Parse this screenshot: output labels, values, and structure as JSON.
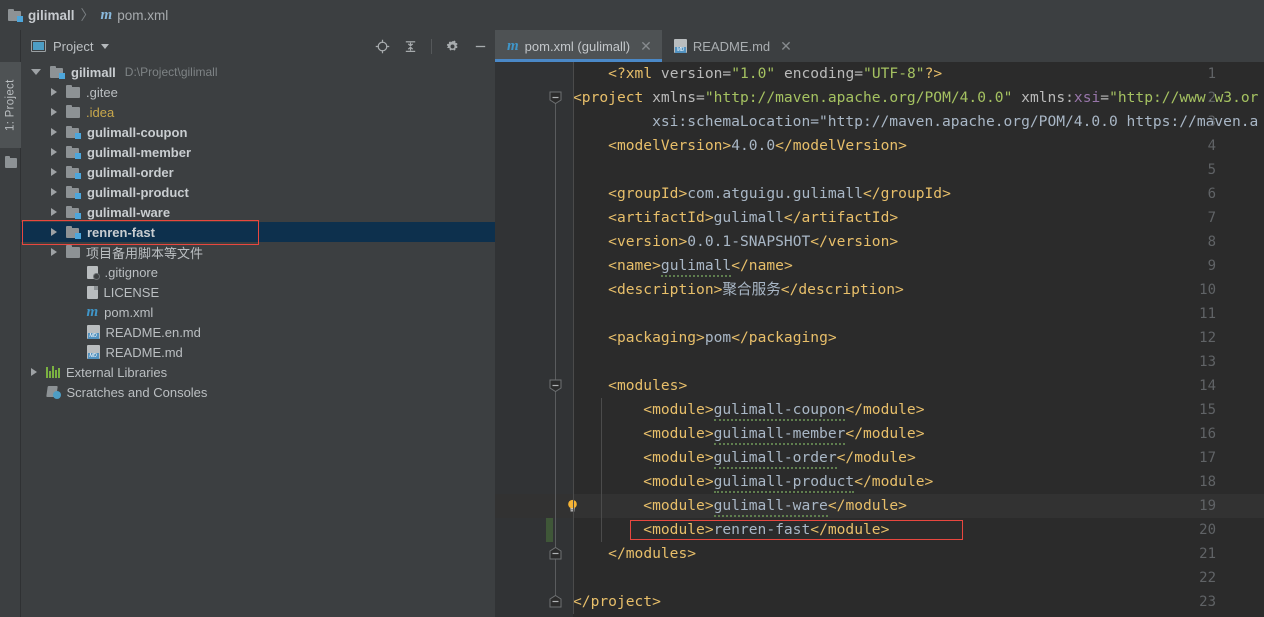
{
  "breadcrumb": {
    "project_icon": "module-icon",
    "project": "gilimall",
    "separator": "〉",
    "file_icon": "maven-m-icon",
    "file": "pom.xml"
  },
  "left_strip": {
    "project_tool_label": "1: Project",
    "folder_icon": "folder-icon"
  },
  "project_panel": {
    "title": "Project",
    "view_icon": "project-view-icon",
    "dropdown_icon": "chevron-down-icon",
    "toolbar": [
      {
        "name": "locate-icon",
        "title": "Select Opened File"
      },
      {
        "name": "collapse-all-icon",
        "title": "Collapse All"
      },
      {
        "name": "gear-icon",
        "title": "Settings"
      },
      {
        "name": "minimize-icon",
        "title": "Hide"
      }
    ],
    "tree": [
      {
        "label": "gilimall",
        "path": "D:\\Project\\gilimall",
        "icon": "module-icon",
        "arrow": "open",
        "indent": 0,
        "bold": true
      },
      {
        "label": ".gitee",
        "path": "",
        "icon": "folder-icon",
        "arrow": "closed",
        "indent": 1,
        "bold": false
      },
      {
        "label": ".idea",
        "path": "",
        "icon": "folder-icon",
        "arrow": "closed",
        "indent": 1,
        "bold": false,
        "yellow": true
      },
      {
        "label": "gulimall-coupon",
        "path": "",
        "icon": "module-icon",
        "arrow": "closed",
        "indent": 1,
        "bold": true
      },
      {
        "label": "gulimall-member",
        "path": "",
        "icon": "module-icon",
        "arrow": "closed",
        "indent": 1,
        "bold": true
      },
      {
        "label": "gulimall-order",
        "path": "",
        "icon": "module-icon",
        "arrow": "closed",
        "indent": 1,
        "bold": true
      },
      {
        "label": "gulimall-product",
        "path": "",
        "icon": "module-icon",
        "arrow": "closed",
        "indent": 1,
        "bold": true
      },
      {
        "label": "gulimall-ware",
        "path": "",
        "icon": "module-icon",
        "arrow": "closed",
        "indent": 1,
        "bold": true
      },
      {
        "label": "renren-fast",
        "path": "",
        "icon": "module-icon",
        "arrow": "closed",
        "indent": 1,
        "bold": true,
        "selected": true,
        "highlighted": true
      },
      {
        "label": "项目备用脚本等文件",
        "path": "",
        "icon": "folder-icon",
        "arrow": "closed",
        "indent": 1,
        "bold": false
      },
      {
        "label": ".gitignore",
        "path": "",
        "icon": "gitignore-icon",
        "arrow": "none",
        "indent": 2,
        "bold": false
      },
      {
        "label": "LICENSE",
        "path": "",
        "icon": "file-icon",
        "arrow": "none",
        "indent": 2,
        "bold": false
      },
      {
        "label": "pom.xml",
        "path": "",
        "icon": "maven-m-icon",
        "arrow": "none",
        "indent": 2,
        "bold": false
      },
      {
        "label": "README.en.md",
        "path": "",
        "icon": "markdown-icon",
        "arrow": "none",
        "indent": 2,
        "bold": false
      },
      {
        "label": "README.md",
        "path": "",
        "icon": "markdown-icon",
        "arrow": "none",
        "indent": 2,
        "bold": false
      },
      {
        "label": "External Libraries",
        "path": "",
        "icon": "library-icon",
        "arrow": "closed",
        "indent": 0,
        "bold": false
      },
      {
        "label": "Scratches and Consoles",
        "path": "",
        "icon": "scratches-icon",
        "arrow": "none",
        "indent": 0,
        "bold": false
      }
    ]
  },
  "editor": {
    "tabs": [
      {
        "label": "pom.xml (gulimall)",
        "icon": "maven-m-icon",
        "close_icon": "close-icon",
        "active": true
      },
      {
        "label": "README.md",
        "icon": "markdown-icon",
        "close_icon": "close-icon",
        "active": false
      }
    ],
    "caret_line": 19,
    "modified_line": 20,
    "lightbulb_line": 19,
    "highlighted_line": 20,
    "lines": [
      {
        "n": 1,
        "text": "    <?xml version=\"1.0\" encoding=\"UTF-8\"?>"
      },
      {
        "n": 2,
        "text": "<project xmlns=\"http://maven.apache.org/POM/4.0.0\" xmlns:xsi=\"http://www.w3.or"
      },
      {
        "n": 3,
        "text": "         xsi:schemaLocation=\"http://maven.apache.org/POM/4.0.0 https://maven.a"
      },
      {
        "n": 4,
        "text": "    <modelVersion>4.0.0</modelVersion>"
      },
      {
        "n": 5,
        "text": ""
      },
      {
        "n": 6,
        "text": "    <groupId>com.atguigu.gulimall</groupId>"
      },
      {
        "n": 7,
        "text": "    <artifactId>gulimall</artifactId>"
      },
      {
        "n": 8,
        "text": "    <version>0.0.1-SNAPSHOT</version>"
      },
      {
        "n": 9,
        "text": "    <name>gulimall</name>"
      },
      {
        "n": 10,
        "text": "    <description>聚合服务</description>"
      },
      {
        "n": 11,
        "text": ""
      },
      {
        "n": 12,
        "text": "    <packaging>pom</packaging>"
      },
      {
        "n": 13,
        "text": ""
      },
      {
        "n": 14,
        "text": "    <modules>"
      },
      {
        "n": 15,
        "text": "        <module>gulimall-coupon</module>"
      },
      {
        "n": 16,
        "text": "        <module>gulimall-member</module>"
      },
      {
        "n": 17,
        "text": "        <module>gulimall-order</module>"
      },
      {
        "n": 18,
        "text": "        <module>gulimall-product</module>"
      },
      {
        "n": 19,
        "text": "        <module>gulimall-ware</module>"
      },
      {
        "n": 20,
        "text": "        <module>renren-fast</module>"
      },
      {
        "n": 21,
        "text": "    </modules>"
      },
      {
        "n": 22,
        "text": ""
      },
      {
        "n": 23,
        "text": "</project>"
      }
    ]
  },
  "colors": {
    "panel_bg": "#3c3f41",
    "editor_bg": "#2b2b2b",
    "gutter_bg": "#313335",
    "selection_bg": "#0d304d",
    "annotation_red": "#e8473f",
    "tab_active_underline": "#4a88c7",
    "tag": "#e8bf6a",
    "string": "#a5c261",
    "namespace": "#9876aa",
    "text": "#a9b7c6",
    "line_number": "#606366",
    "modified_marker": "#3f5738",
    "lightbulb": "#f5b335"
  }
}
